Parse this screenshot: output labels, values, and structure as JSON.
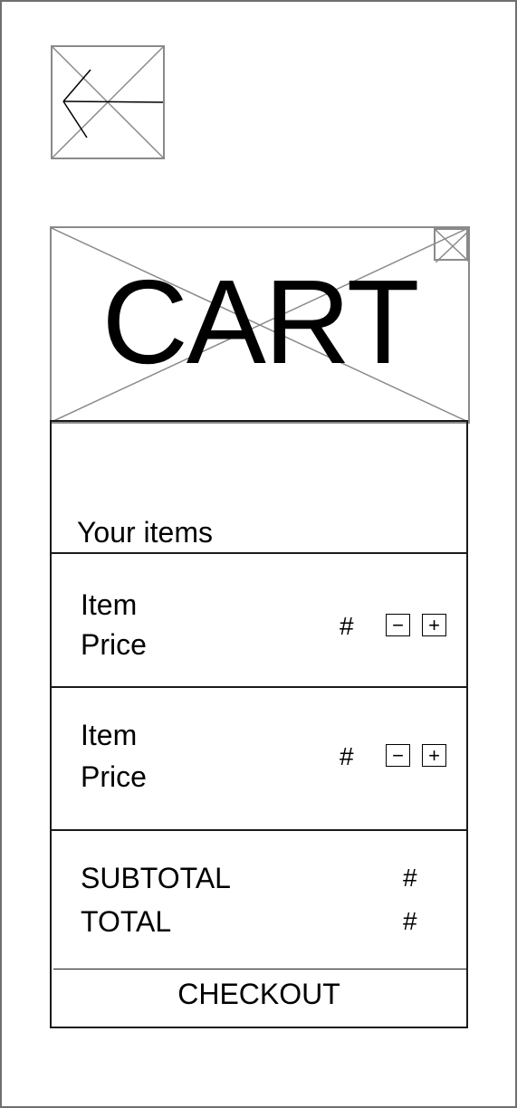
{
  "header": {
    "title": "CART"
  },
  "cart": {
    "heading": "Your items",
    "items": [
      {
        "name": "Item",
        "price": "Price",
        "quantity": "#",
        "decrement": "−",
        "increment": "+"
      },
      {
        "name": "Item",
        "price": "Price",
        "quantity": "#",
        "decrement": "−",
        "increment": "+"
      }
    ]
  },
  "summary": {
    "subtotal_label": "SUBTOTAL",
    "subtotal_value": "#",
    "total_label": "TOTAL",
    "total_value": "#",
    "checkout_label": "CHECKOUT"
  },
  "icons": {
    "back": "back-arrow-icon",
    "close": "close-icon",
    "image_placeholder": "image-placeholder-icon"
  }
}
